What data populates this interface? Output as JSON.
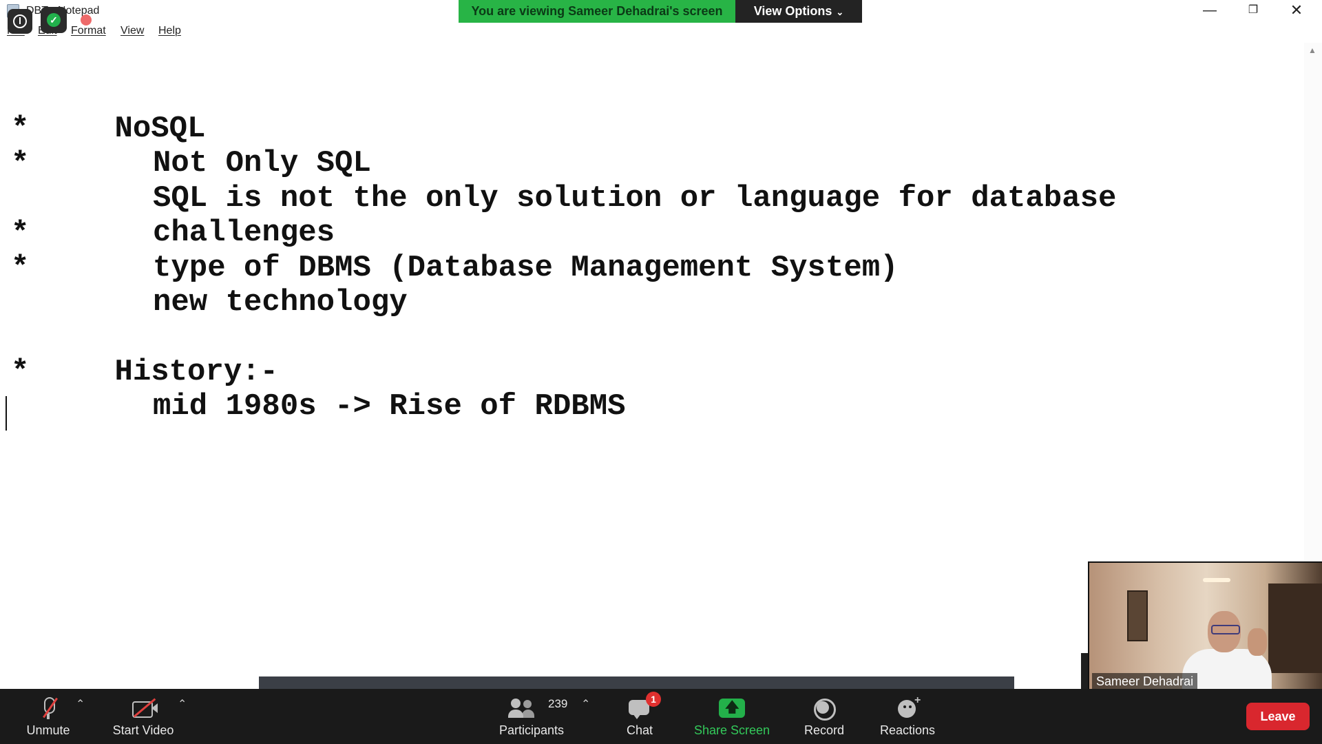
{
  "window": {
    "title": "DBT - Notepad",
    "controls": {
      "minimize": "—",
      "restore": "❐",
      "close": "✕"
    }
  },
  "menu": {
    "file": "File",
    "edit": "Edit",
    "format": "Format",
    "view": "View",
    "help": "Help"
  },
  "editor": {
    "lines": [
      {
        "bullet": "",
        "text": "NoSQL",
        "indent": false
      },
      {
        "bullet": "*",
        "text": "Not Only SQL",
        "indent": true
      },
      {
        "bullet": "*",
        "text": "SQL is not the only solution or language for database",
        "indent": true
      },
      {
        "bullet": "",
        "text": "challenges",
        "indent": true
      },
      {
        "bullet": "*",
        "text": "type of DBMS (Database Management System)",
        "indent": true
      },
      {
        "bullet": "*",
        "text": "new technology",
        "indent": true
      },
      {
        "bullet": "",
        "text": "",
        "indent": false
      },
      {
        "bullet": "",
        "text": "History:-",
        "indent": false
      },
      {
        "bullet": "*",
        "text": "mid 1980s -> Rise of RDBMS",
        "indent": true
      }
    ]
  },
  "share_banner": {
    "notice": "You are viewing Sameer Dehadrai's screen",
    "view_options": "View Options",
    "accent": "#28b446"
  },
  "presenter": {
    "name": "Sameer Dehadrai"
  },
  "toolbar": {
    "unmute": "Unmute",
    "start_video": "Start Video",
    "participants": "Participants",
    "participants_count": "239",
    "chat": "Chat",
    "chat_badge": "1",
    "share_screen": "Share Screen",
    "record": "Record",
    "reactions": "Reactions",
    "leave": "Leave",
    "caret": "⌃",
    "share_accent": "#23b04a",
    "leave_color": "#d9272e"
  }
}
